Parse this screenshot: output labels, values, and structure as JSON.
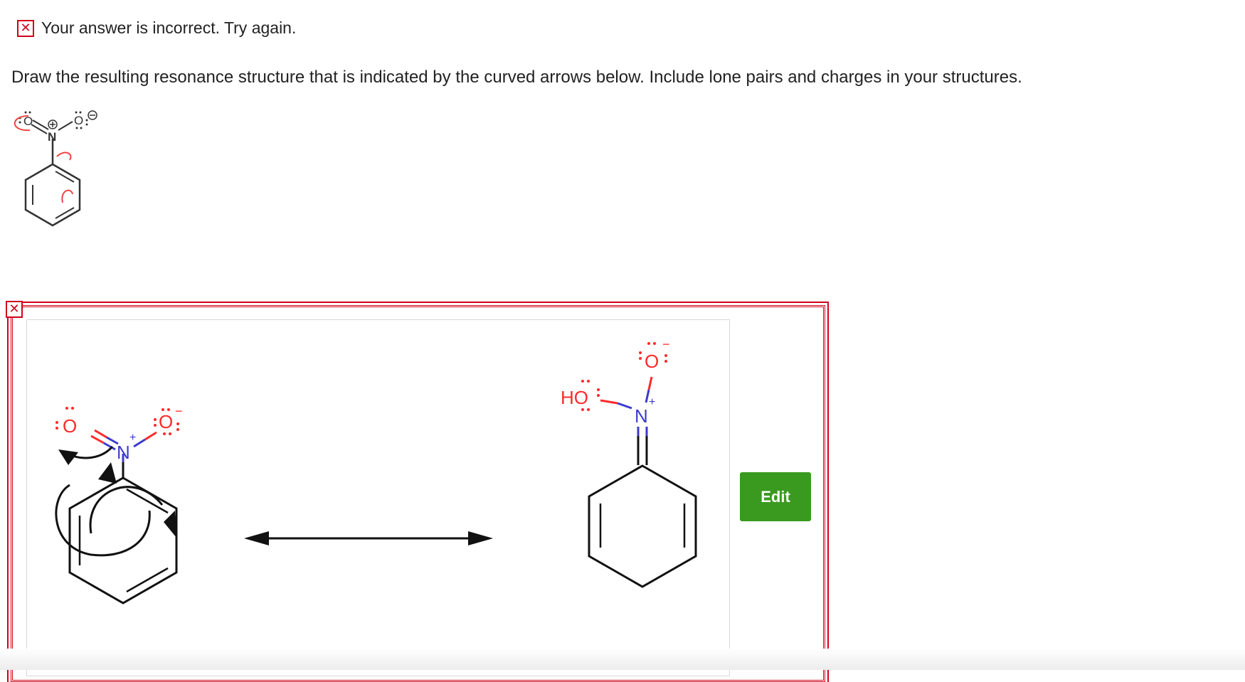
{
  "feedback": {
    "icon": "x-mark-icon",
    "text": "Your answer is incorrect.  Try again."
  },
  "question": {
    "text": "Draw the resulting resonance structure that is indicated by the curved arrows below. Include lone pairs and charges in your structures."
  },
  "answer": {
    "status_icon": "x-mark-icon",
    "edit_label": "Edit",
    "atoms": {
      "oxygen": "O",
      "nitrogen": "N",
      "hydroxyl": "HO",
      "plus": "+",
      "minus": "−"
    }
  },
  "colors": {
    "error": "#d0021b",
    "edit_button": "#3a9a1f",
    "oxygen": "#ff2a2a",
    "nitrogen": "#3b3bcf",
    "arrow": "#ee4444"
  }
}
